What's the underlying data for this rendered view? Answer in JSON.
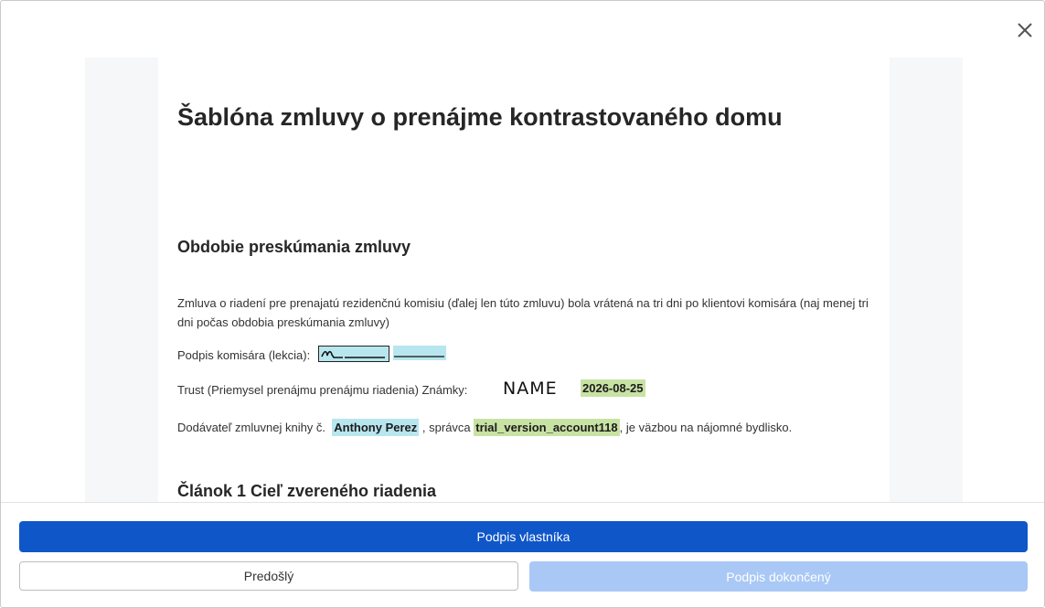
{
  "dialog": {
    "close_icon": "close-icon"
  },
  "document": {
    "title": "Šablóna zmluvy o prenájme kontrastovaného domu",
    "section1": {
      "heading": "Obdobie preskúmania zmluvy",
      "paragraph": "Zmluva o riadení pre prenajatú rezidenčnú komisiu (ďalej len túto zmluvu) bola vrátená na tri dni po klientovi komisára (naj menej tri dni počas obdobia preskúmania zmluvy)",
      "signature_label": "Podpis komisára (lekcia):",
      "trust_label": "Trust (Priemysel prenájmu prenájmu riadenia) Známky:",
      "stamp_text": "NAME",
      "date_value": "2026-08-25",
      "supplier_prefix": "Dodávateľ zmluvnej knihy č.",
      "supplier_name": "Anthony Perez",
      "supplier_mid": ", správca",
      "account": "trial_version_account118",
      "supplier_suffix": ", je väzbou na nájomné bydlisko."
    },
    "section2": {
      "heading": "Článok 1 Cieľ zvereného riadenia"
    }
  },
  "footer": {
    "primary_label": "Podpis vlastníka",
    "previous_label": "Predošlý",
    "done_label": "Podpis dokončený"
  },
  "colors": {
    "primary": "#0f56c9",
    "disabled": "#a9c8f6",
    "field_blue": "#b8e6ee",
    "field_green": "#c8e2a4"
  }
}
